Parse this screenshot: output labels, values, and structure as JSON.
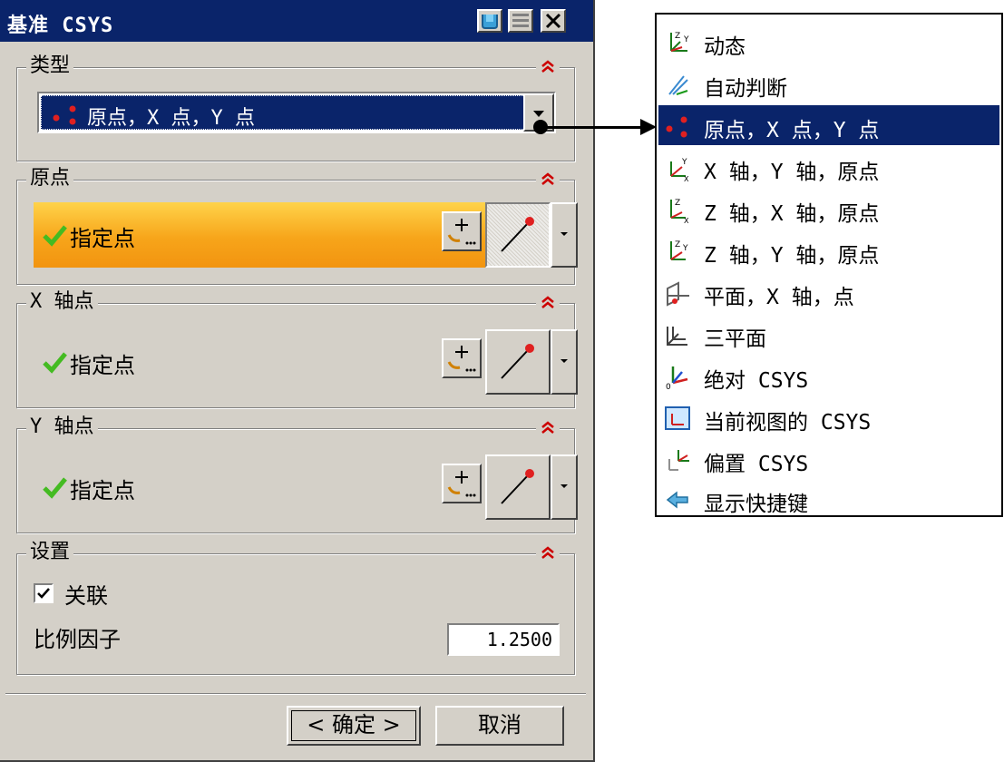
{
  "dialog": {
    "title": "基准 CSYS",
    "type_group": {
      "title": "类型",
      "selected": "原点，X 点，Y 点"
    },
    "origin_group": {
      "title": "原点",
      "specify_label": "指定点"
    },
    "xpoint_group": {
      "title": "X 轴点",
      "specify_label": "指定点"
    },
    "ypoint_group": {
      "title": "Y 轴点",
      "specify_label": "指定点"
    },
    "settings_group": {
      "title": "设置",
      "associative_label": "关联",
      "associative_checked": true,
      "scale_label": "比例因子",
      "scale_value": "1.2500"
    },
    "ok_label": "< 确定 >",
    "cancel_label": "取消"
  },
  "type_menu": {
    "items": [
      {
        "label": "动态",
        "icon": "dynamic-csys-icon"
      },
      {
        "label": "自动判断",
        "icon": "inferred-icon"
      },
      {
        "label": "原点，X 点，Y 点",
        "icon": "three-points-icon",
        "selected": true
      },
      {
        "label": "X 轴，Y 轴，原点",
        "icon": "x-y-axis-origin-icon"
      },
      {
        "label": "Z 轴，X 轴，原点",
        "icon": "z-x-axis-origin-icon"
      },
      {
        "label": "Z 轴，Y 轴，原点",
        "icon": "z-y-axis-origin-icon"
      },
      {
        "label": "平面，X 轴，点",
        "icon": "plane-axis-point-icon"
      },
      {
        "label": "三平面",
        "icon": "three-planes-icon"
      },
      {
        "label": "绝对 CSYS",
        "icon": "absolute-csys-icon"
      },
      {
        "label": "当前视图的 CSYS",
        "icon": "view-csys-icon"
      },
      {
        "label": "偏置 CSYS",
        "icon": "offset-csys-icon"
      },
      {
        "label": "显示快捷键",
        "icon": "show-shortcuts-icon"
      }
    ]
  },
  "colors": {
    "titlebar": "#0a246a",
    "panel": "#d4d0c8",
    "active_row": "#f7a51a",
    "check": "#44bb22",
    "collapse": "#cc0000"
  }
}
